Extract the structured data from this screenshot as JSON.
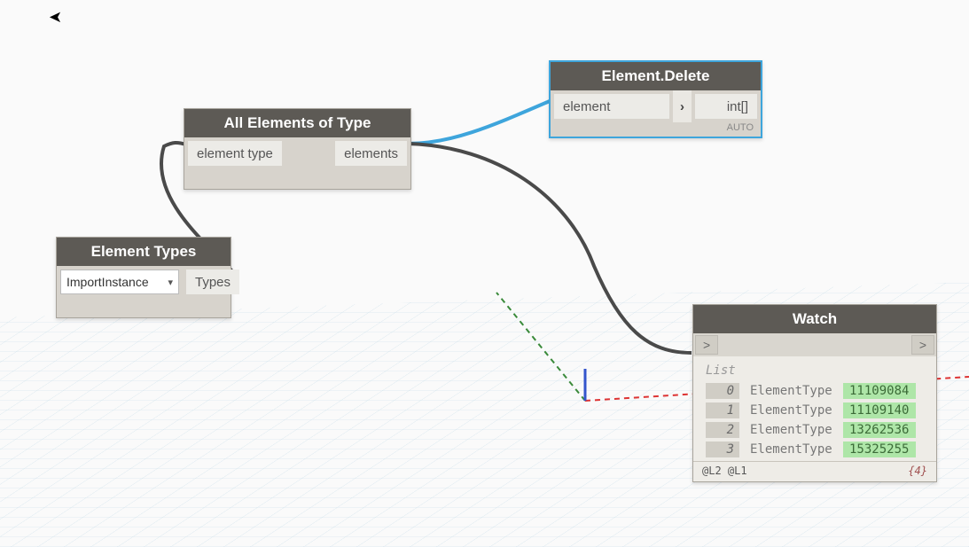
{
  "nodes": {
    "elementTypes": {
      "title": "Element Types",
      "dropdownValue": "ImportInstance",
      "outPort": "Types"
    },
    "allElements": {
      "title": "All Elements of Type",
      "inPort": "element type",
      "outPort": "elements"
    },
    "elementDelete": {
      "title": "Element.Delete",
      "inPort": "element",
      "outPort": "int[]",
      "autoLabel": "AUTO"
    },
    "watch": {
      "title": "Watch",
      "listLabel": "List",
      "items": [
        {
          "index": "0",
          "type": "ElementType",
          "id": "11109084"
        },
        {
          "index": "1",
          "type": "ElementType",
          "id": "11109140"
        },
        {
          "index": "2",
          "type": "ElementType",
          "id": "13262536"
        },
        {
          "index": "3",
          "type": "ElementType",
          "id": "15325255"
        }
      ],
      "footerLeft": "@L2 @L1",
      "footerRight": "{4}",
      "gt": ">"
    }
  }
}
